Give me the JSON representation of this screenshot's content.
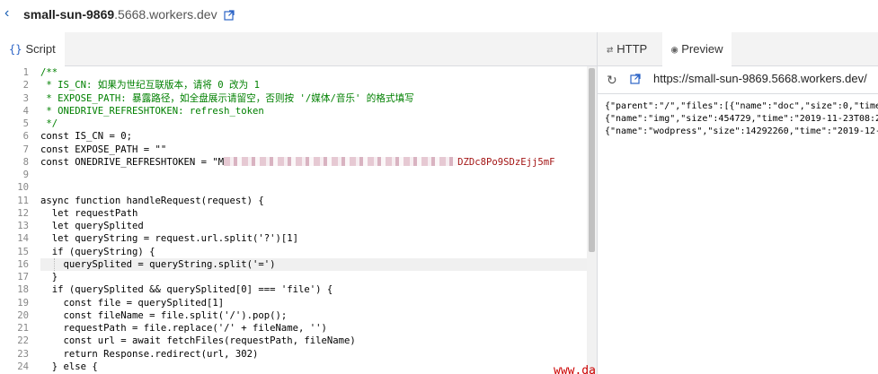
{
  "header": {
    "worker_name": "small-sun-9869",
    "domain": ".5668.workers.dev"
  },
  "left_tabs": {
    "script": "Script"
  },
  "right_tabs": {
    "http": "HTTP",
    "preview": "Preview"
  },
  "preview": {
    "url": "https://small-sun-9869.5668.workers.dev/",
    "lines": [
      "{\"parent\":\"/\",\"files\":[{\"name\":\"doc\",\"size\":0,\"time",
      "{\"name\":\"img\",\"size\":454729,\"time\":\"2019-11-23T08:2",
      "{\"name\":\"wodpress\",\"size\":14292260,\"time\":\"2019-12-"
    ]
  },
  "code": {
    "line_numbers": [
      "1",
      "2",
      "3",
      "4",
      "5",
      "6",
      "7",
      "8",
      "9",
      "10",
      "11",
      "12",
      "13",
      "14",
      "15",
      "16",
      "17",
      "18",
      "19",
      "20",
      "21",
      "22",
      "23",
      "24"
    ],
    "lines": [
      "/**",
      " * IS_CN: 如果为世纪互联版本，请将 0 改为 1",
      " * EXPOSE_PATH: 暴露路径，如全盘展示请留空，否则按 '/媒体/音乐' 的格式填写",
      " * ONEDRIVE_REFRESHTOKEN: refresh_token",
      " */",
      "const IS_CN = 0;",
      "const EXPOSE_PATH = \"\"",
      "const ONEDRIVE_REFRESHTOKEN = \"M",
      "",
      "",
      "async function handleRequest(request) {",
      "  let requestPath",
      "  let querySplited",
      "  let queryString = request.url.split('?')[1]",
      "  if (queryString) {",
      "    querySplited = queryString.split('=')",
      "  }",
      "  if (querySplited && querySplited[0] === 'file') {",
      "    const file = querySplited[1]",
      "    const fileName = file.split('/').pop();",
      "    requestPath = file.replace('/' + fileName, '')",
      "    const url = await fetchFiles(requestPath, fileName)",
      "    return Response.redirect(url, 302)",
      "  } else {"
    ],
    "token_tail": "DZDc8Po9SDzEjj5mF"
  },
  "watermark": "www.daniao.org",
  "icons": {
    "back": "back-chevron-icon",
    "external": "external-link-icon",
    "script": "braces-icon",
    "http": "arrows-icon",
    "preview": "eye-icon",
    "refresh": "refresh-icon"
  },
  "colors": {
    "accent": "#2b63c6",
    "comment": "#008000",
    "keyword": "#0000ff",
    "string": "#a31515"
  }
}
